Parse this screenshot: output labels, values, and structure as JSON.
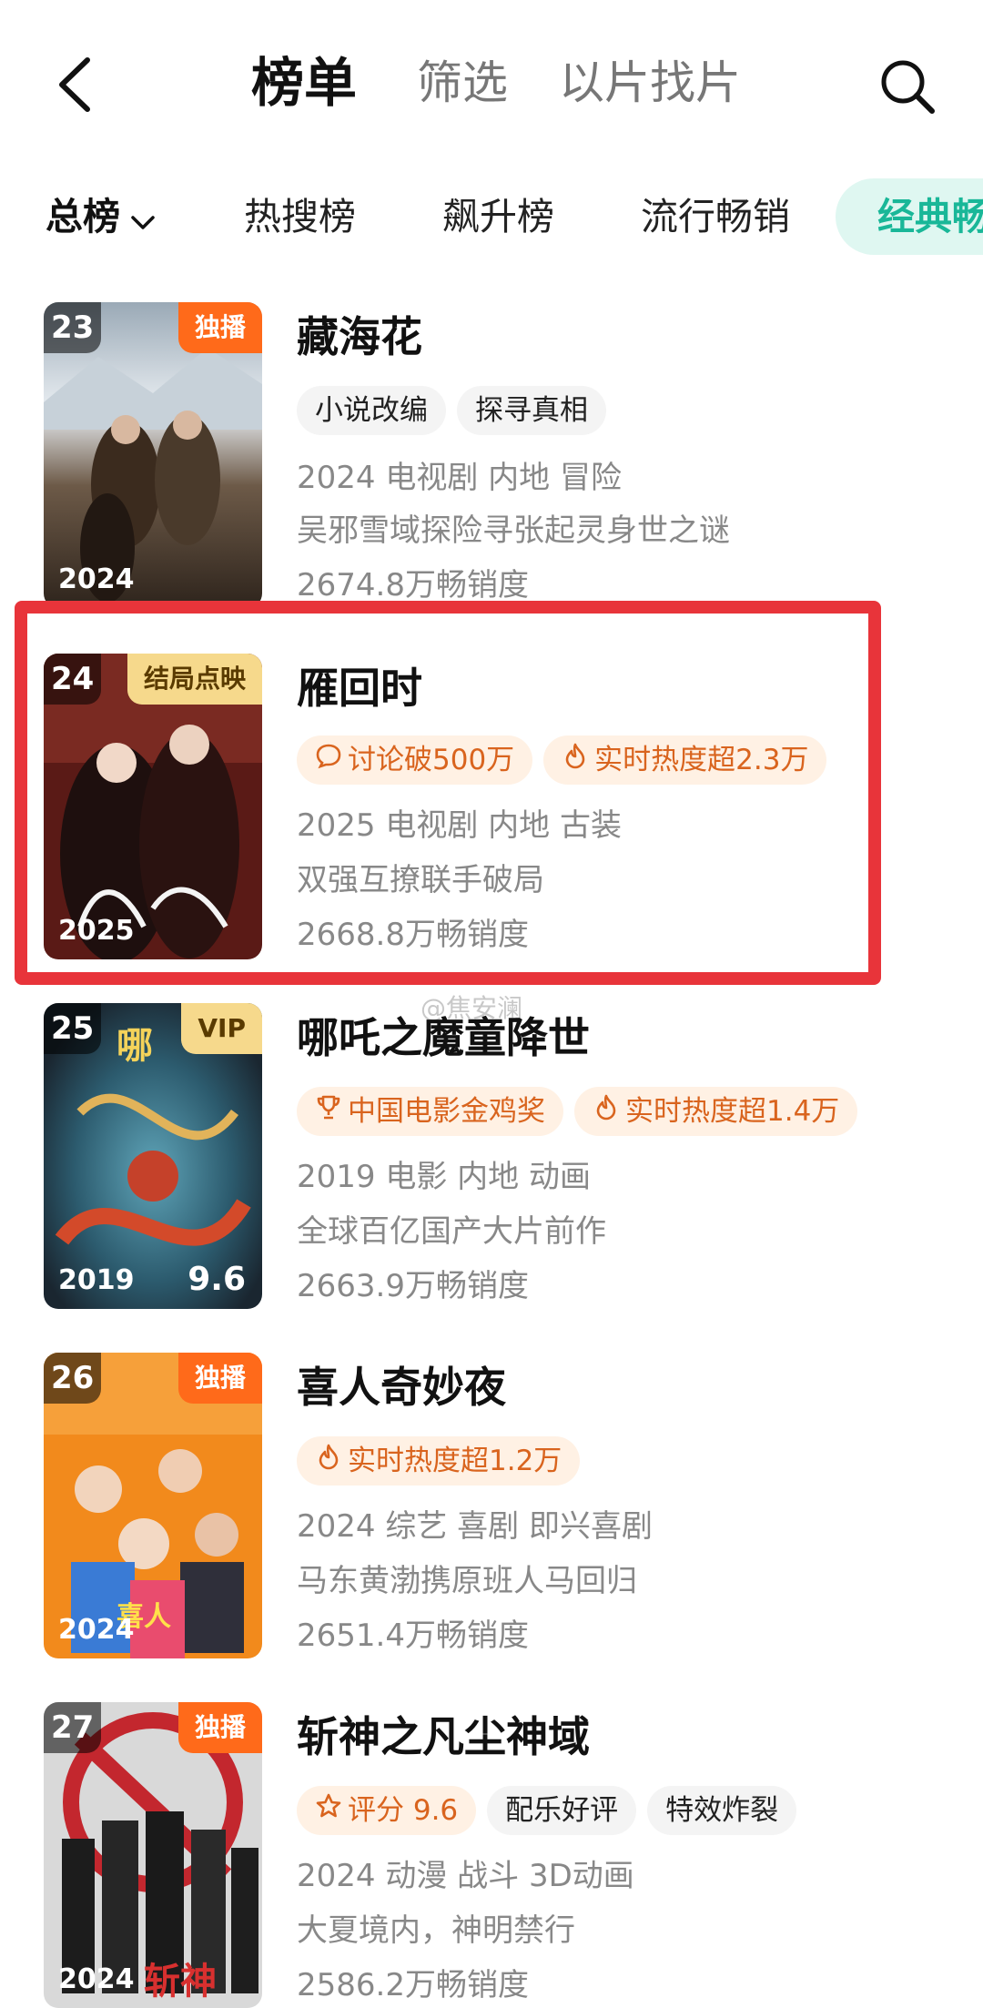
{
  "header": {
    "tabs": [
      {
        "label": "榜单",
        "active": true
      },
      {
        "label": "筛选",
        "active": false
      },
      {
        "label": "以片找片",
        "active": false
      }
    ]
  },
  "categories": [
    {
      "label": "总榜"
    },
    {
      "label": "热搜榜"
    },
    {
      "label": "飙升榜"
    },
    {
      "label": "流行畅销"
    },
    {
      "label": "经典畅",
      "selected": true
    }
  ],
  "items": [
    {
      "rank": "23",
      "corner": "独播",
      "year": "2024",
      "title": "藏海花",
      "tags": [
        "小说改编",
        "探寻真相"
      ],
      "meta": "2024 电视剧 内地 冒险",
      "desc": "吴邪雪域探险寻张起灵身世之谜",
      "sales": "2674.8万畅销度"
    },
    {
      "rank": "24",
      "corner": "结局点映",
      "year": "2025",
      "title": "雁回时",
      "tags": [
        "讨论破500万",
        "实时热度超2.3万"
      ],
      "meta": "2025 电视剧 内地 古装",
      "desc": "双强互撩联手破局",
      "sales": "2668.8万畅销度"
    },
    {
      "rank": "25",
      "corner": "VIP",
      "year": "2019",
      "score": "9.6",
      "title": "哪吒之魔童降世",
      "tags": [
        "中国电影金鸡奖",
        "实时热度超1.4万"
      ],
      "meta": "2019 电影 内地 动画",
      "desc": "全球百亿国产大片前作",
      "sales": "2663.9万畅销度"
    },
    {
      "rank": "26",
      "corner": "独播",
      "year": "2024",
      "title": "喜人奇妙夜",
      "tags": [
        "实时热度超1.2万"
      ],
      "meta": "2024 综艺 喜剧 即兴喜剧",
      "desc": "马东黄渤携原班人马回归",
      "sales": "2651.4万畅销度"
    },
    {
      "rank": "27",
      "corner": "独播",
      "year": "2024",
      "title": "斩神之凡尘神域",
      "tags": [
        "评分 9.6",
        "配乐好评",
        "特效炸裂"
      ],
      "meta": "2024 动漫 战斗 3D动画",
      "desc": "大夏境内，神明禁行",
      "sales": "2586.2万畅销度"
    }
  ],
  "watermark": "@焦安澜",
  "colors": {
    "accent": "#19b798",
    "hot": "#d9641e",
    "highlight": "#e8343a",
    "exclusive": "#ff6a1a"
  }
}
